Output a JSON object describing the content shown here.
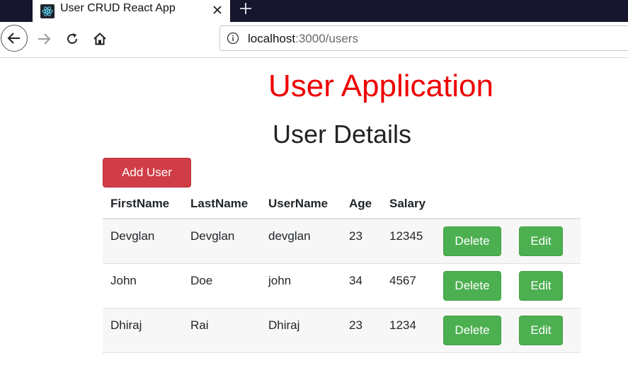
{
  "browser": {
    "tab": {
      "title": "User CRUD React App",
      "favicon": "react-logo-icon"
    },
    "url": {
      "host": "localhost",
      "path": ":3000/users"
    }
  },
  "page": {
    "app_title": "User Application",
    "section_title": "User Details",
    "add_button": "Add User",
    "colors": {
      "title": "#ee0000",
      "add_button": "#d13d46",
      "action_button": "#4caf50"
    },
    "table": {
      "headers": [
        "FirstName",
        "LastName",
        "UserName",
        "Age",
        "Salary"
      ],
      "rows": [
        {
          "first": "Devglan",
          "last": "Devglan",
          "username": "devglan",
          "age": "23",
          "salary": "12345",
          "delete": "Delete",
          "edit": "Edit"
        },
        {
          "first": "John",
          "last": "Doe",
          "username": "john",
          "age": "34",
          "salary": "4567",
          "delete": "Delete",
          "edit": "Edit"
        },
        {
          "first": "Dhiraj",
          "last": "Rai",
          "username": "Dhiraj",
          "age": "23",
          "salary": "1234",
          "delete": "Delete",
          "edit": "Edit"
        }
      ]
    }
  }
}
